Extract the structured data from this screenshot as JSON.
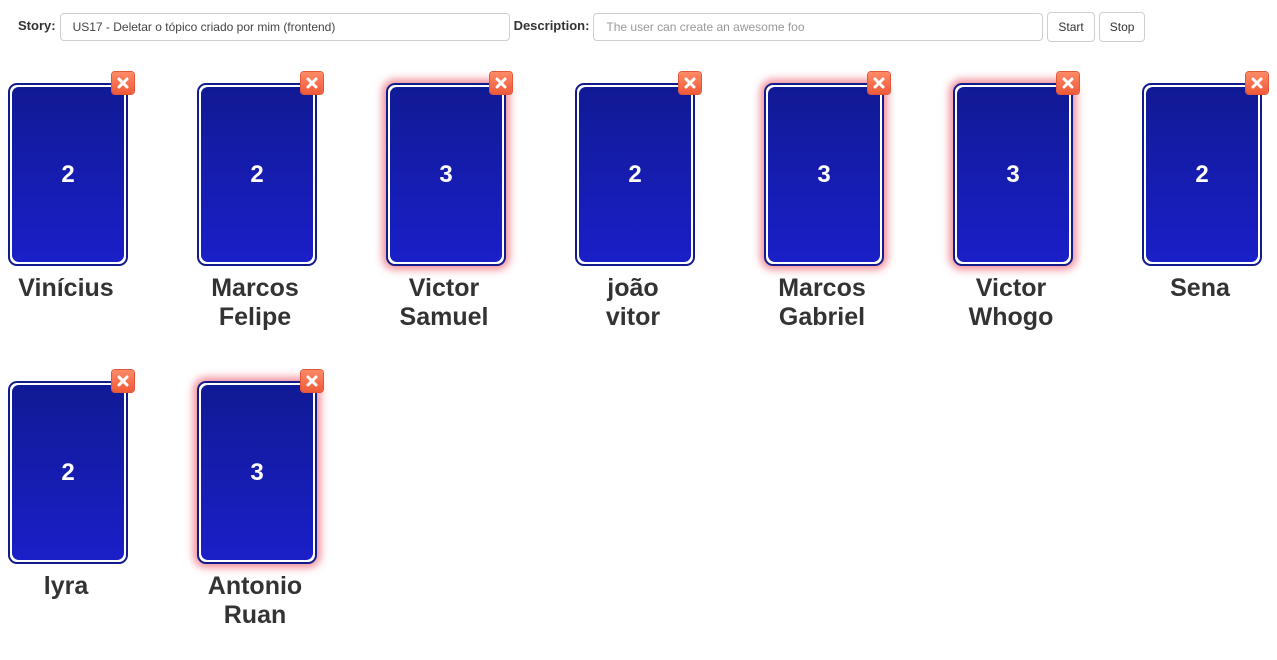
{
  "header": {
    "story_label": "Story:",
    "story_value": "US17 - Deletar o tópico criado por mim (frontend)",
    "description_label": "Description:",
    "description_placeholder": "The user can create an awesome foo",
    "start_label": "Start",
    "stop_label": "Stop"
  },
  "players": [
    {
      "name": "Vinícius",
      "vote": "2",
      "highlighted": false
    },
    {
      "name": "Marcos\nFelipe",
      "vote": "2",
      "highlighted": false
    },
    {
      "name": "Victor\nSamuel",
      "vote": "3",
      "highlighted": true
    },
    {
      "name": "joão\nvitor",
      "vote": "2",
      "highlighted": false
    },
    {
      "name": "Marcos\nGabriel",
      "vote": "3",
      "highlighted": true
    },
    {
      "name": "Victor\nWhogo",
      "vote": "3",
      "highlighted": true
    },
    {
      "name": "Sena",
      "vote": "2",
      "highlighted": false
    },
    {
      "name": "lyra",
      "vote": "2",
      "highlighted": false
    },
    {
      "name": "Antonio\nRuan",
      "vote": "3",
      "highlighted": true
    }
  ],
  "colors": {
    "card_face": "#1a1fc8",
    "card_border": "#111b8c",
    "highlight_glow": "#e63c50",
    "remove_button": "#ef5a3a"
  },
  "icons": {
    "remove": "close-icon"
  }
}
